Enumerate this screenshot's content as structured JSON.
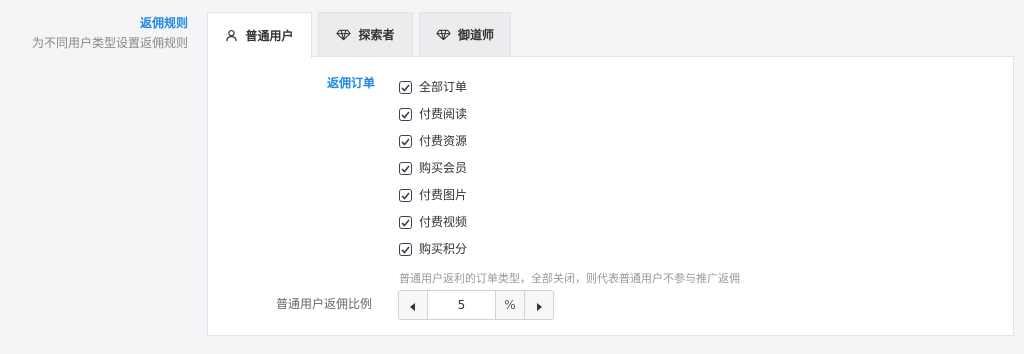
{
  "section": {
    "title": "返佣规则",
    "description": "为不同用户类型设置返佣规则"
  },
  "tabs": [
    {
      "label": "普通用户",
      "icon": "user-icon",
      "active": true
    },
    {
      "label": "探索者",
      "icon": "diamond-icon",
      "active": false
    },
    {
      "label": "御道师",
      "icon": "diamond-icon",
      "active": false
    }
  ],
  "rebate_orders": {
    "label": "返佣订单",
    "options": [
      {
        "label": "全部订单",
        "checked": true
      },
      {
        "label": "付费阅读",
        "checked": true
      },
      {
        "label": "付费资源",
        "checked": true
      },
      {
        "label": "购买会员",
        "checked": true
      },
      {
        "label": "付费图片",
        "checked": true
      },
      {
        "label": "付费视频",
        "checked": true
      },
      {
        "label": "购买积分",
        "checked": true
      }
    ],
    "help": "普通用户返利的订单类型，全部关闭，则代表普通用户不参与推广返佣"
  },
  "ratio": {
    "label": "普通用户返佣比例",
    "value": "5",
    "unit": "%"
  },
  "colors": {
    "accent": "#1e88e5",
    "checkbox": "#3b4250"
  }
}
